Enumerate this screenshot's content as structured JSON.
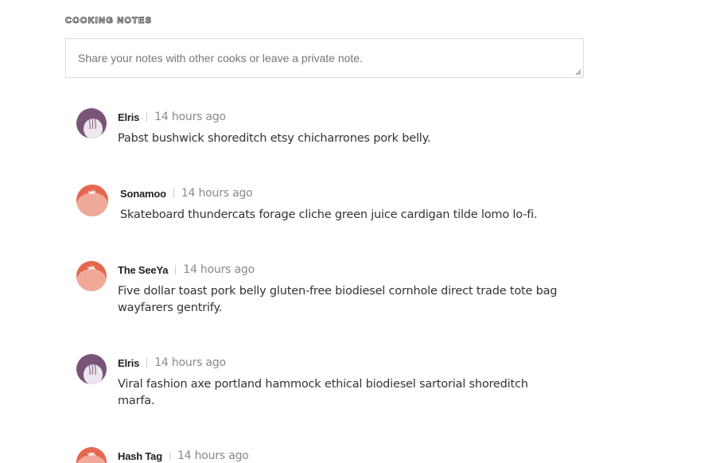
{
  "section": {
    "heading": "Cooking Notes"
  },
  "notes_input": {
    "placeholder": "Share your notes with other cooks or leave a private note.",
    "value": ""
  },
  "comments": [
    {
      "author": "Elris",
      "time": "14 hours ago",
      "text": "Pabst bushwick shoreditch etsy chicharrones pork belly.",
      "avatar_icon": "onion-avatar-icon"
    },
    {
      "author": "Sonamoo",
      "time": "14 hours ago",
      "text": "Skateboard thundercats forage cliche green juice cardigan tilde lomo lo-fi.",
      "avatar_icon": "tomato-avatar-icon"
    },
    {
      "author": "The SeeYa",
      "time": "14 hours ago",
      "text": "Five dollar toast pork belly gluten-free biodiesel cornhole direct trade tote bag wayfarers gentrify.",
      "avatar_icon": "tomato-avatar-icon"
    },
    {
      "author": "Elris",
      "time": "14 hours ago",
      "text": "Viral fashion axe portland hammock ethical biodiesel sartorial shoreditch marfa.",
      "avatar_icon": "onion-avatar-icon"
    },
    {
      "author": "Hash Tag",
      "time": "14 hours ago",
      "text": "",
      "avatar_icon": "tomato-avatar-icon"
    }
  ],
  "colors": {
    "onion": "#7a5478",
    "tomato": "#e4684f",
    "tomato_light": "#f0a899",
    "time": "#888888"
  }
}
